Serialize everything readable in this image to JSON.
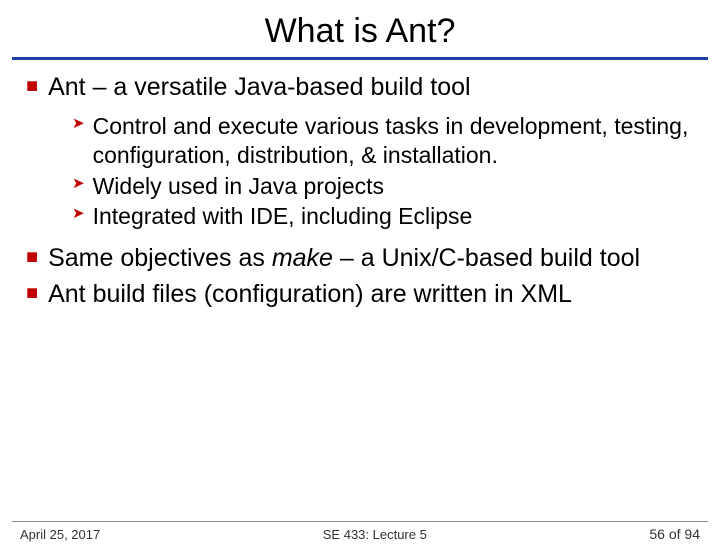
{
  "title": "What is Ant?",
  "bullets": {
    "b1": "Ant – a versatile Java-based build tool",
    "s1": "Control and execute various tasks in development, testing, configuration, distribution, & installation.",
    "s2": "Widely used in Java projects",
    "s3": "Integrated with IDE, including Eclipse",
    "b2a": "Same objectives as ",
    "b2b": "make",
    "b2c": " – a Unix/C-based build tool",
    "b3": "Ant build files (configuration) are written in XML"
  },
  "footer": {
    "date": "April 25, 2017",
    "course": "SE 433: Lecture 5",
    "page": "56 of 94"
  }
}
